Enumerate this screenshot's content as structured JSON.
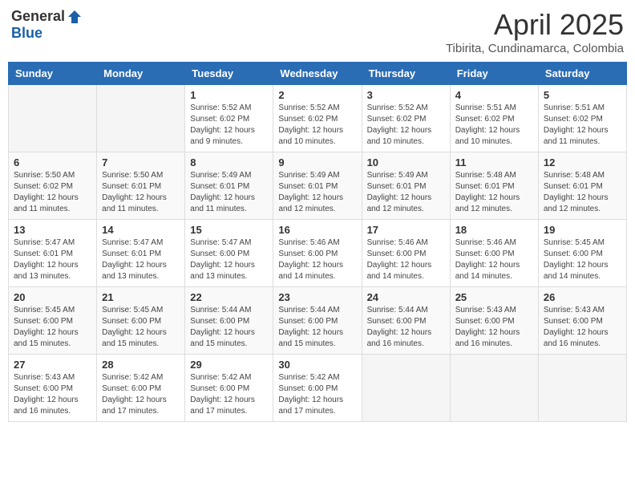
{
  "header": {
    "logo_general": "General",
    "logo_blue": "Blue",
    "title": "April 2025",
    "subtitle": "Tibirita, Cundinamarca, Colombia"
  },
  "weekdays": [
    "Sunday",
    "Monday",
    "Tuesday",
    "Wednesday",
    "Thursday",
    "Friday",
    "Saturday"
  ],
  "weeks": [
    [
      {
        "day": "",
        "info": ""
      },
      {
        "day": "",
        "info": ""
      },
      {
        "day": "1",
        "info": "Sunrise: 5:52 AM\nSunset: 6:02 PM\nDaylight: 12 hours and 9 minutes."
      },
      {
        "day": "2",
        "info": "Sunrise: 5:52 AM\nSunset: 6:02 PM\nDaylight: 12 hours and 10 minutes."
      },
      {
        "day": "3",
        "info": "Sunrise: 5:52 AM\nSunset: 6:02 PM\nDaylight: 12 hours and 10 minutes."
      },
      {
        "day": "4",
        "info": "Sunrise: 5:51 AM\nSunset: 6:02 PM\nDaylight: 12 hours and 10 minutes."
      },
      {
        "day": "5",
        "info": "Sunrise: 5:51 AM\nSunset: 6:02 PM\nDaylight: 12 hours and 11 minutes."
      }
    ],
    [
      {
        "day": "6",
        "info": "Sunrise: 5:50 AM\nSunset: 6:02 PM\nDaylight: 12 hours and 11 minutes."
      },
      {
        "day": "7",
        "info": "Sunrise: 5:50 AM\nSunset: 6:01 PM\nDaylight: 12 hours and 11 minutes."
      },
      {
        "day": "8",
        "info": "Sunrise: 5:49 AM\nSunset: 6:01 PM\nDaylight: 12 hours and 11 minutes."
      },
      {
        "day": "9",
        "info": "Sunrise: 5:49 AM\nSunset: 6:01 PM\nDaylight: 12 hours and 12 minutes."
      },
      {
        "day": "10",
        "info": "Sunrise: 5:49 AM\nSunset: 6:01 PM\nDaylight: 12 hours and 12 minutes."
      },
      {
        "day": "11",
        "info": "Sunrise: 5:48 AM\nSunset: 6:01 PM\nDaylight: 12 hours and 12 minutes."
      },
      {
        "day": "12",
        "info": "Sunrise: 5:48 AM\nSunset: 6:01 PM\nDaylight: 12 hours and 12 minutes."
      }
    ],
    [
      {
        "day": "13",
        "info": "Sunrise: 5:47 AM\nSunset: 6:01 PM\nDaylight: 12 hours and 13 minutes."
      },
      {
        "day": "14",
        "info": "Sunrise: 5:47 AM\nSunset: 6:01 PM\nDaylight: 12 hours and 13 minutes."
      },
      {
        "day": "15",
        "info": "Sunrise: 5:47 AM\nSunset: 6:00 PM\nDaylight: 12 hours and 13 minutes."
      },
      {
        "day": "16",
        "info": "Sunrise: 5:46 AM\nSunset: 6:00 PM\nDaylight: 12 hours and 14 minutes."
      },
      {
        "day": "17",
        "info": "Sunrise: 5:46 AM\nSunset: 6:00 PM\nDaylight: 12 hours and 14 minutes."
      },
      {
        "day": "18",
        "info": "Sunrise: 5:46 AM\nSunset: 6:00 PM\nDaylight: 12 hours and 14 minutes."
      },
      {
        "day": "19",
        "info": "Sunrise: 5:45 AM\nSunset: 6:00 PM\nDaylight: 12 hours and 14 minutes."
      }
    ],
    [
      {
        "day": "20",
        "info": "Sunrise: 5:45 AM\nSunset: 6:00 PM\nDaylight: 12 hours and 15 minutes."
      },
      {
        "day": "21",
        "info": "Sunrise: 5:45 AM\nSunset: 6:00 PM\nDaylight: 12 hours and 15 minutes."
      },
      {
        "day": "22",
        "info": "Sunrise: 5:44 AM\nSunset: 6:00 PM\nDaylight: 12 hours and 15 minutes."
      },
      {
        "day": "23",
        "info": "Sunrise: 5:44 AM\nSunset: 6:00 PM\nDaylight: 12 hours and 15 minutes."
      },
      {
        "day": "24",
        "info": "Sunrise: 5:44 AM\nSunset: 6:00 PM\nDaylight: 12 hours and 16 minutes."
      },
      {
        "day": "25",
        "info": "Sunrise: 5:43 AM\nSunset: 6:00 PM\nDaylight: 12 hours and 16 minutes."
      },
      {
        "day": "26",
        "info": "Sunrise: 5:43 AM\nSunset: 6:00 PM\nDaylight: 12 hours and 16 minutes."
      }
    ],
    [
      {
        "day": "27",
        "info": "Sunrise: 5:43 AM\nSunset: 6:00 PM\nDaylight: 12 hours and 16 minutes."
      },
      {
        "day": "28",
        "info": "Sunrise: 5:42 AM\nSunset: 6:00 PM\nDaylight: 12 hours and 17 minutes."
      },
      {
        "day": "29",
        "info": "Sunrise: 5:42 AM\nSunset: 6:00 PM\nDaylight: 12 hours and 17 minutes."
      },
      {
        "day": "30",
        "info": "Sunrise: 5:42 AM\nSunset: 6:00 PM\nDaylight: 12 hours and 17 minutes."
      },
      {
        "day": "",
        "info": ""
      },
      {
        "day": "",
        "info": ""
      },
      {
        "day": "",
        "info": ""
      }
    ]
  ]
}
